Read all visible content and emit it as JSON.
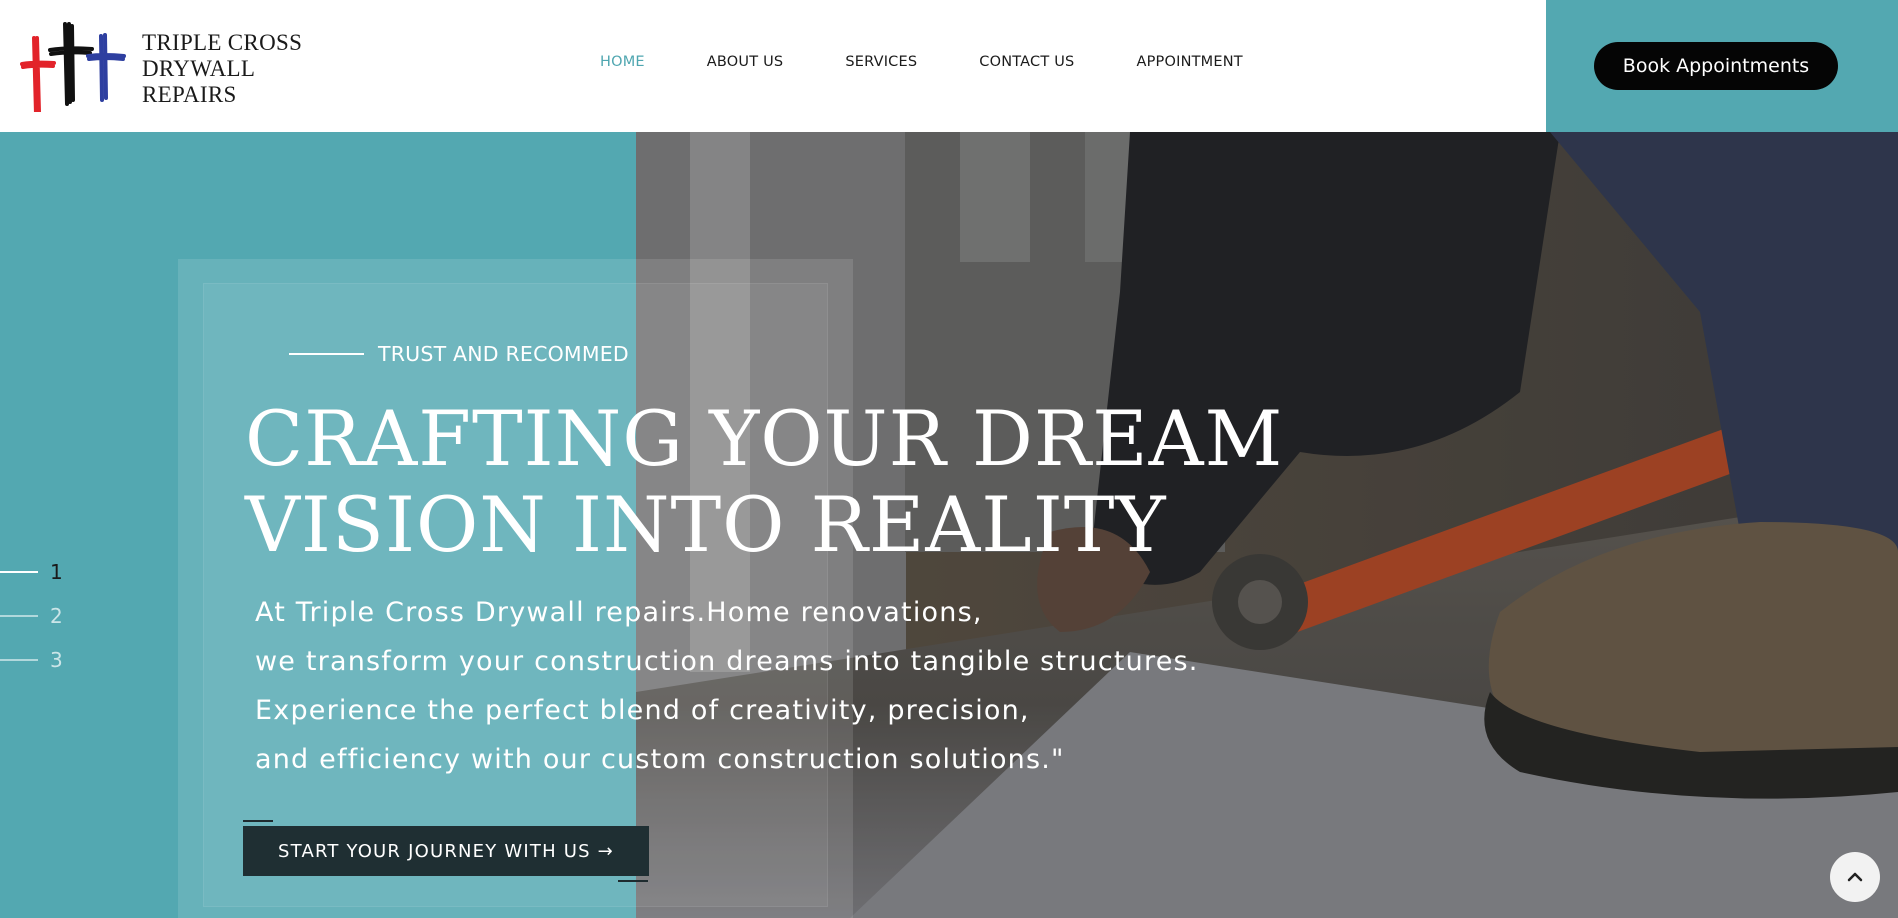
{
  "logo": {
    "line1": "TRIPLE CROSS",
    "line2": "DRYWALL",
    "line3": "REPAIRS",
    "cross_colors": [
      "#e2232a",
      "#111111",
      "#2e3fa0"
    ]
  },
  "nav": {
    "items": [
      {
        "label": "HOME",
        "active": true
      },
      {
        "label": "ABOUT US",
        "active": false
      },
      {
        "label": "SERVICES",
        "active": false
      },
      {
        "label": "CONTACT US",
        "active": false
      },
      {
        "label": "APPOINTMENT",
        "active": false
      }
    ]
  },
  "header_cta": {
    "label": "Book Appointments"
  },
  "hero": {
    "eyebrow": "TRUST AND RECOMMED",
    "headline": [
      "CRAFTING YOUR DREAM",
      "VISION INTO REALITY"
    ],
    "description": [
      "At Triple Cross Drywall repairs.Home renovations,",
      "we transform your construction dreams into tangible structures.",
      "Experience the perfect blend of creativity, precision,",
      "and efficiency with our custom construction solutions.\""
    ],
    "cta_label": "START YOUR JOURNEY WITH US →",
    "slides": [
      "1",
      "2",
      "3"
    ],
    "active_slide": 1
  },
  "colors": {
    "teal": "#53a8b1",
    "nav_active": "#4fa6b0",
    "dark_button": "#1f2f33"
  },
  "icons": {
    "scroll_top": "chevron-up-icon"
  }
}
